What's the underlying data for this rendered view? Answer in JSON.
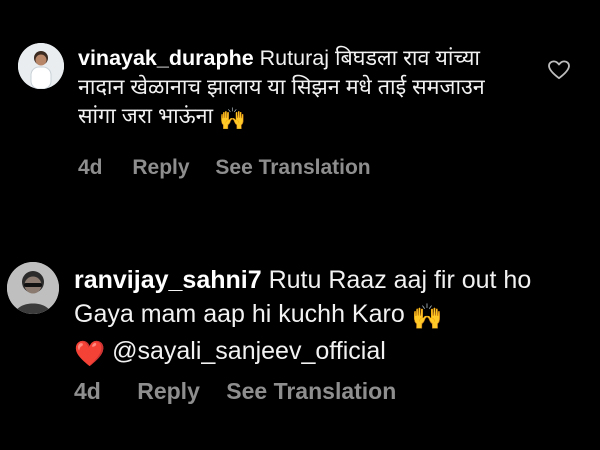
{
  "comments": [
    {
      "username": "vinayak_duraphe",
      "text": "Ruturaj बिघडला राव यांच्या नादान खेळानाच झालाय या सिझन मधे ताई समजाउन सांगा जरा भाऊंना",
      "emoji_after": "🙌",
      "time": "4d",
      "reply_label": "Reply",
      "translate_label": "See Translation"
    },
    {
      "username": "ranvijay_sahni7",
      "text": "Rutu Raaz aaj fir out ho Gaya mam aap hi kuchh Karo",
      "emoji_after": "🙌",
      "heart": "❤️",
      "mention": "@sayali_sanjeev_official",
      "time": "4d",
      "reply_label": "Reply",
      "translate_label": "See Translation"
    }
  ],
  "icons": {
    "like": "heart-outline-icon"
  }
}
